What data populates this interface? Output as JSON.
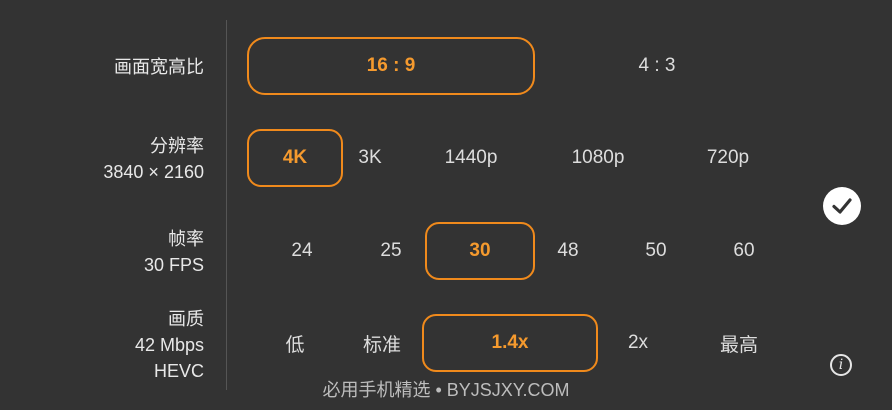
{
  "aspect": {
    "label": "画面宽高比",
    "options": [
      "16 : 9",
      "4 : 3"
    ],
    "selected": "16 : 9"
  },
  "resolution": {
    "label": "分辨率",
    "detail": "3840 × 2160",
    "options": [
      "4K",
      "3K",
      "1440p",
      "1080p",
      "720p"
    ],
    "selected": "4K"
  },
  "framerate": {
    "label": "帧率",
    "detail": "30 FPS",
    "options": [
      "24",
      "25",
      "30",
      "48",
      "50",
      "60"
    ],
    "selected": "30"
  },
  "quality": {
    "label": "画质",
    "detail1": "42 Mbps",
    "detail2": "HEVC",
    "options": [
      "低",
      "标准",
      "1.4x",
      "2x",
      "最高"
    ],
    "selected": "1.4x"
  },
  "icons": {
    "confirm": "check-circle-icon",
    "info": "info-icon",
    "info_glyph": "i"
  },
  "watermark": "必用手机精选 • BYJSJXY.COM",
  "colors": {
    "background": "#333333",
    "accent": "#f08a1c",
    "text": "#e6e6e6"
  }
}
